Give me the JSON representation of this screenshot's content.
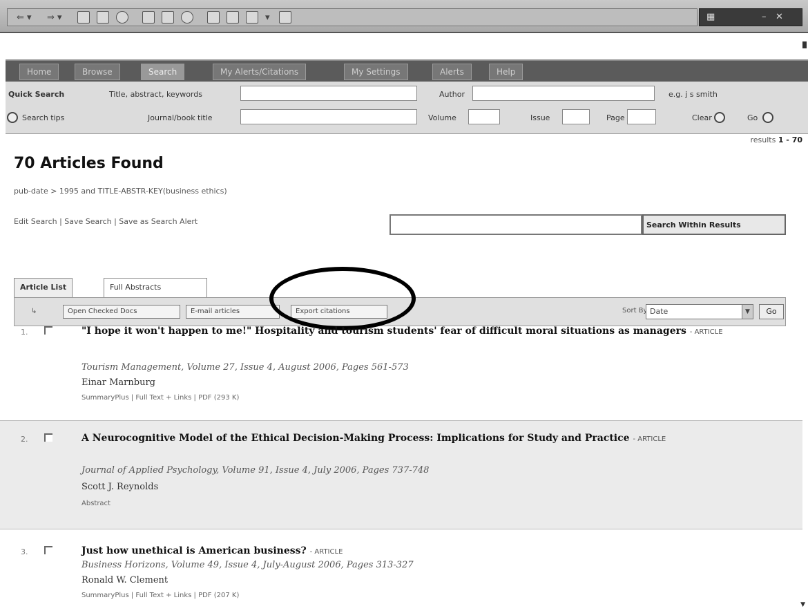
{
  "nav": {
    "tabs": [
      "Home",
      "Browse",
      "Search",
      "My Alerts/Citations",
      "My Settings",
      "Alerts",
      "Help"
    ]
  },
  "quick_search": {
    "label": "Quick Search",
    "search_tips": "Search tips",
    "keywords_label": "Title, abstract, keywords",
    "author_label": "Author",
    "author_hint": "e.g. j s smith",
    "journal_label": "Journal/book title",
    "volume_label": "Volume",
    "issue_label": "Issue",
    "page_label": "Page",
    "clear_label": "Clear",
    "go_label": "Go"
  },
  "results": {
    "range_prefix": "results",
    "range": "1 - 70",
    "title": "70 Articles Found",
    "query": "pub-date > 1995 and TITLE-ABSTR-KEY(business ethics)",
    "edit_search": "Edit Search",
    "save_search": "Save Search",
    "save_alert": "Save as Search Alert",
    "within_button": "Search Within Results"
  },
  "list_tabs": [
    "Article List",
    "Full Abstracts"
  ],
  "actions": {
    "open_checked": "Open Checked Docs",
    "email": "E-mail articles",
    "export": "Export citations",
    "sort_label": "Sort By:",
    "sort_value": "Date",
    "go": "Go"
  },
  "articles": [
    {
      "num": "1.",
      "title": "\"I hope it won't happen to me!\" Hospitality and tourism students' fear of difficult moral situations as managers",
      "type": "ARTICLE",
      "source": "Tourism Management, Volume 27, Issue 4, August 2006, Pages 561-573",
      "author": "Einar Marnburg",
      "links": "SummaryPlus | Full Text + Links | PDF (293 K)"
    },
    {
      "num": "2.",
      "title": "A Neurocognitive Model of the Ethical Decision-Making Process: Implications for Study and Practice",
      "type": "ARTICLE",
      "source": "Journal of Applied Psychology, Volume 91, Issue 4, July 2006, Pages 737-748",
      "author": "Scott J. Reynolds",
      "links": "Abstract"
    },
    {
      "num": "3.",
      "title": "Just how unethical is American business?",
      "type": "ARTICLE",
      "source": "Business Horizons, Volume 49, Issue 4, July-August 2006, Pages 313-327",
      "author": "Ronald W. Clement",
      "links": "SummaryPlus | Full Text + Links | PDF (207 K)"
    }
  ]
}
